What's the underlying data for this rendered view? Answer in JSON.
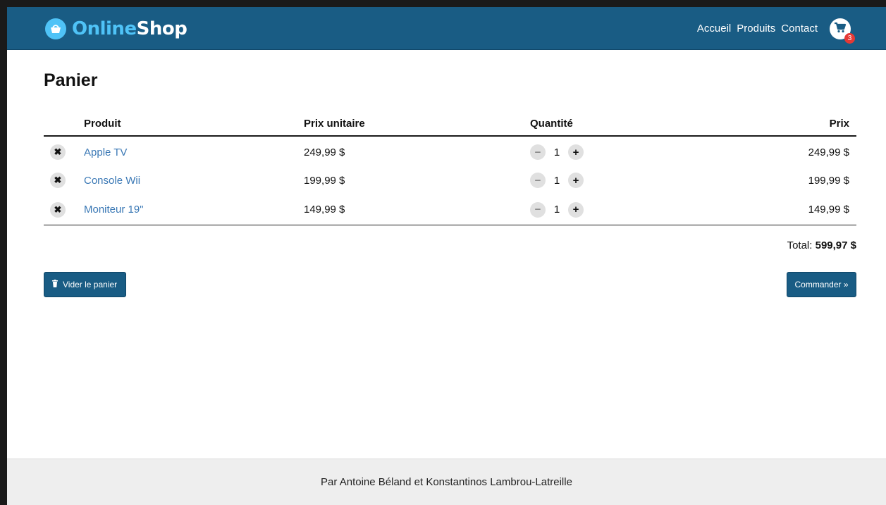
{
  "header": {
    "logo_part1": "Online",
    "logo_part2": "Shop",
    "nav": [
      "Accueil",
      "Produits",
      "Contact"
    ],
    "cart_count": "3",
    "brand_color": "#195c84"
  },
  "page": {
    "title": "Panier"
  },
  "cart_table": {
    "columns": [
      "",
      "Produit",
      "Prix unitaire",
      "Quantité",
      "Prix"
    ],
    "rows": [
      {
        "product": "Apple TV",
        "unit_price": "249,99 $",
        "quantity": "1",
        "price": "249,99 $"
      },
      {
        "product": "Console Wii",
        "unit_price": "199,99 $",
        "quantity": "1",
        "price": "199,99 $"
      },
      {
        "product": "Moniteur 19\"",
        "unit_price": "149,99 $",
        "quantity": "1",
        "price": "149,99 $"
      }
    ]
  },
  "summary": {
    "total_label": "Total:",
    "total_value": "599,97 $"
  },
  "actions": {
    "clear_label": "Vider le panier",
    "order_label": "Commander »"
  },
  "footer": {
    "text": "Par Antoine Béland et Konstantinos Lambrou-Latreille"
  },
  "icons": {
    "remove": "close-icon",
    "minus": "minus-icon",
    "plus": "plus-icon",
    "trash": "trash-icon",
    "cart": "cart-icon",
    "logo": "basket-icon"
  }
}
